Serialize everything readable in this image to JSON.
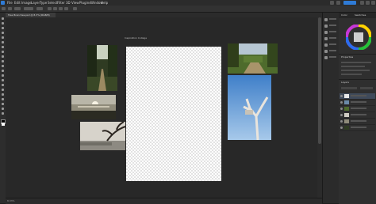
{
  "menu": {
    "items": [
      "File",
      "Edit",
      "Image",
      "Layer",
      "Type",
      "Select",
      "Filter",
      "3D",
      "View",
      "Plugins",
      "Window",
      "Help"
    ]
  },
  "document": {
    "tab_title": "Tree Branches.psd @ 8.3% (RGB/8)",
    "canvas_label": "Inspiration Collage",
    "zoom": "8.33%"
  },
  "panels": {
    "color_tab": "Color",
    "swatches_tab": "Swatches",
    "properties_tab": "Properties",
    "layers_tab": "Layers"
  },
  "colors": {
    "accent": "#2f7bd6",
    "background": "#1e1e1e",
    "panel": "#2f2f2f"
  }
}
